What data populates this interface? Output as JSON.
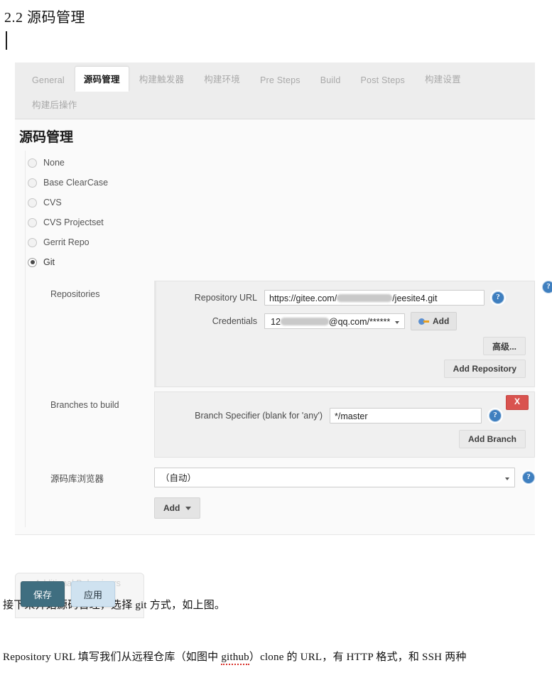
{
  "document": {
    "heading": "2.2 源码管理",
    "paragraph_1": "接下来开始源码管理，选择 git 方式，如上图。",
    "paragraph_2_pre": "Repository URL 填写我们从远程仓库（如图中 ",
    "paragraph_2_misspelled": "github",
    "paragraph_2_post": "）clone 的 URL，有 HTTP 格式，和 SSH 两种"
  },
  "screenshot": {
    "tabs": [
      {
        "label": "General",
        "active": false
      },
      {
        "label": "源码管理",
        "active": true
      },
      {
        "label": "构建触发器",
        "active": false
      },
      {
        "label": "构建环境",
        "active": false
      },
      {
        "label": "Pre Steps",
        "active": false
      },
      {
        "label": "Build",
        "active": false
      },
      {
        "label": "Post Steps",
        "active": false
      },
      {
        "label": "构建设置",
        "active": false
      },
      {
        "label": "构建后操作",
        "active": false
      }
    ],
    "panel_title": "源码管理",
    "scm_options": [
      {
        "label": "None",
        "selected": false
      },
      {
        "label": "Base ClearCase",
        "selected": false
      },
      {
        "label": "CVS",
        "selected": false
      },
      {
        "label": "CVS Projectset",
        "selected": false
      },
      {
        "label": "Gerrit Repo",
        "selected": false
      },
      {
        "label": "Git",
        "selected": true
      }
    ],
    "repositories": {
      "section_label": "Repositories",
      "repository_url_label": "Repository URL",
      "repository_url_prefix": "https://gitee.com/",
      "repository_url_suffix": "/jeesite4.git",
      "credentials_label": "Credentials",
      "credentials_value_prefix": "12",
      "credentials_value_suffix": "@qq.com/******",
      "add_credentials_label": "Add",
      "advanced_label": "高级...",
      "add_repository_label": "Add Repository"
    },
    "branches": {
      "section_label": "Branches to build",
      "delete_label": "X",
      "branch_specifier_label": "Branch Specifier (blank for 'any')",
      "branch_specifier_value": "*/master",
      "add_branch_label": "Add Branch"
    },
    "repository_browser": {
      "label": "源码库浏览器",
      "value": "（自动）"
    },
    "additional_behaviours": {
      "label": "Additional Behaviours",
      "add_label": "Add"
    },
    "footer_buttons": {
      "save_label": "保存",
      "apply_label": "应用"
    },
    "help_icon_glyph": "?",
    "colors": {
      "accent_blue": "#3f7fbf",
      "danger_red": "#d9534f",
      "save_teal": "#3f6e80",
      "apply_blue": "#cfe2f0",
      "tabbar_grey": "#ededed",
      "panel_grey": "#fafafa"
    }
  }
}
